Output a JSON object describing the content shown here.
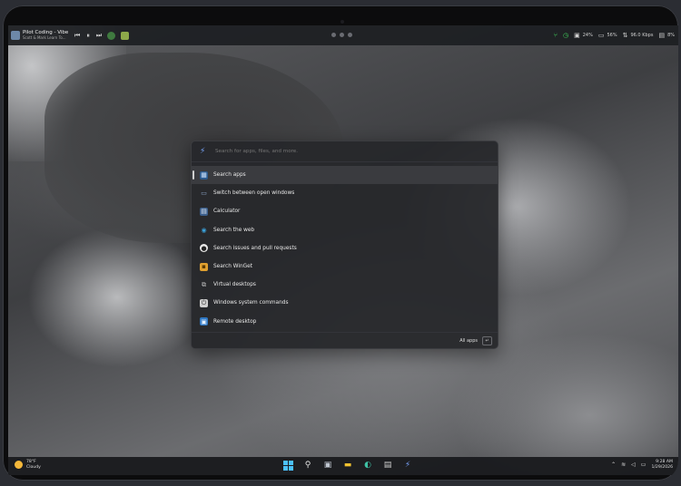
{
  "topbar": {
    "media_title": "Pilot Coding - Vibe...",
    "media_subtitle": "Scott & Mark Learn To...",
    "controls": {
      "prev": "⏮",
      "pause": "⏸",
      "next": "⏭"
    },
    "stats": {
      "cpu": "24%",
      "memory": "56%",
      "network": "96.0 Kbps",
      "gpu": "8%"
    }
  },
  "launcher": {
    "search_placeholder": "Search for apps, files, and more.",
    "items": [
      {
        "label": "Search apps",
        "icon": "apps-grid-icon",
        "color": "#4f8fd8"
      },
      {
        "label": "Switch between open windows",
        "icon": "window-switch-icon",
        "color": "#8aa4c8"
      },
      {
        "label": "Calculator",
        "icon": "calculator-icon",
        "color": "#5a7fb0"
      },
      {
        "label": "Search the web",
        "icon": "globe-icon",
        "color": "#3aa0d8"
      },
      {
        "label": "Search issues and pull requests",
        "icon": "github-icon",
        "color": "#e8e8e8"
      },
      {
        "label": "Search WinGet",
        "icon": "package-icon",
        "color": "#e0a030"
      },
      {
        "label": "Virtual desktops",
        "icon": "desktops-icon",
        "color": "#a8a8a8"
      },
      {
        "label": "Windows system commands",
        "icon": "system-commands-icon",
        "color": "#d0d0d0"
      },
      {
        "label": "Remote desktop",
        "icon": "remote-desktop-icon",
        "color": "#4f9de0"
      }
    ],
    "footer_label": "All apps",
    "enter_glyph": "↵"
  },
  "taskbar": {
    "weather_temp": "78°F",
    "weather_desc": "Cloudy",
    "time": "9:28 AM",
    "date": "1/29/2026"
  }
}
